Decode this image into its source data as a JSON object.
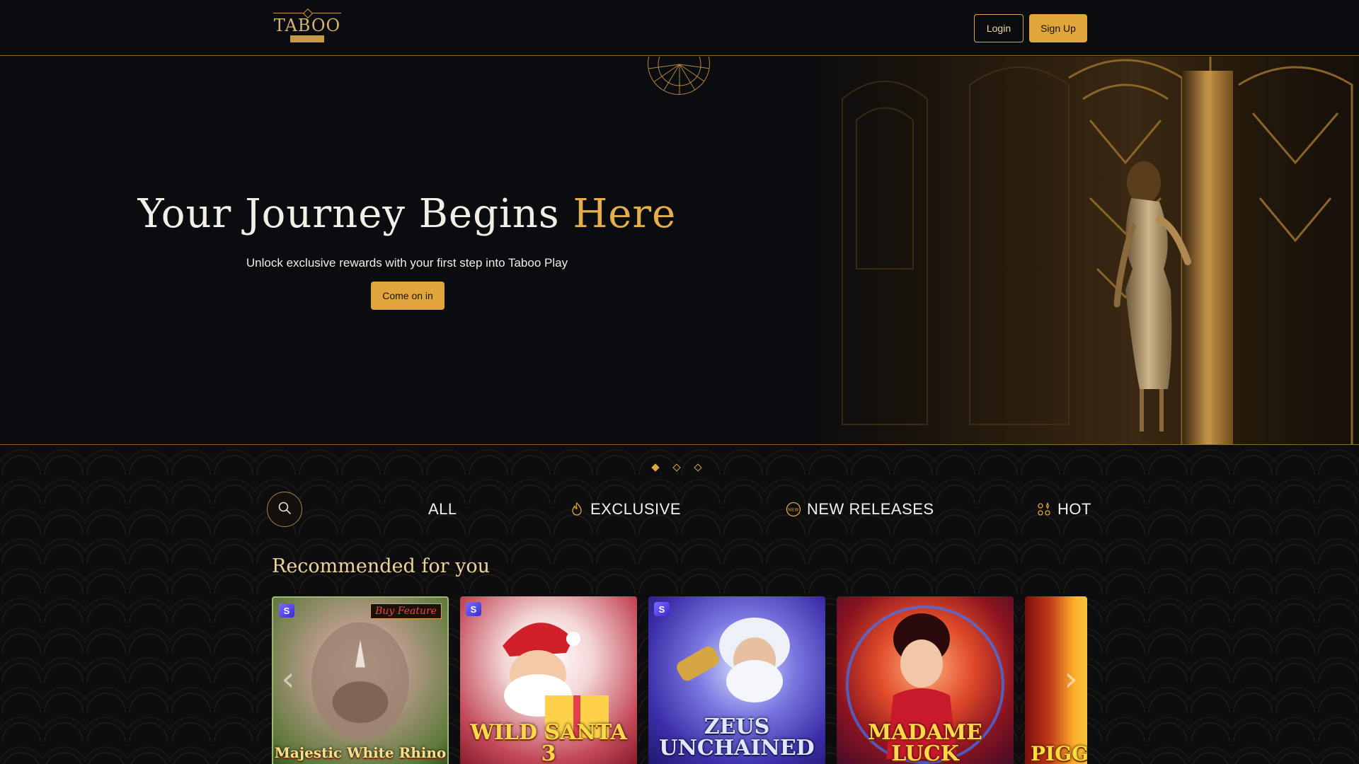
{
  "header": {
    "logo_text": "TABOO",
    "logo_sub": "",
    "login_label": "Login",
    "signup_label": "Sign Up"
  },
  "hero": {
    "title_main": "Your Journey Begins",
    "title_accent": "Here",
    "subtitle": "Unlock exclusive rewards with your first step into Taboo Play",
    "cta_label": "Come on in"
  },
  "slider": {
    "dots": 3,
    "active_index": 0
  },
  "tabs": [
    {
      "label": "ALL",
      "icon": ""
    },
    {
      "label": "EXCLUSIVE",
      "icon": "flame-icon"
    },
    {
      "label": "NEW RELEASES",
      "icon": "new-badge-icon"
    },
    {
      "label": "HOT",
      "icon": "grid-sparkle-icon"
    }
  ],
  "recommended": {
    "title": "Recommended for you",
    "games": [
      {
        "name": "Majestic White Rhino",
        "badge": "S",
        "ribbon": "Buy Feature"
      },
      {
        "name": "WILD SANTA 3",
        "badge": "S"
      },
      {
        "name": "ZEUS UNCHAINED",
        "badge": "S"
      },
      {
        "name": "MADAME LUCK"
      },
      {
        "name": "PIGG"
      }
    ]
  },
  "colors": {
    "accent": "#e0a63c",
    "accent_text": "#e6ad4c",
    "background": "#0a0b0e",
    "border_gold": "#8a6a2c"
  }
}
